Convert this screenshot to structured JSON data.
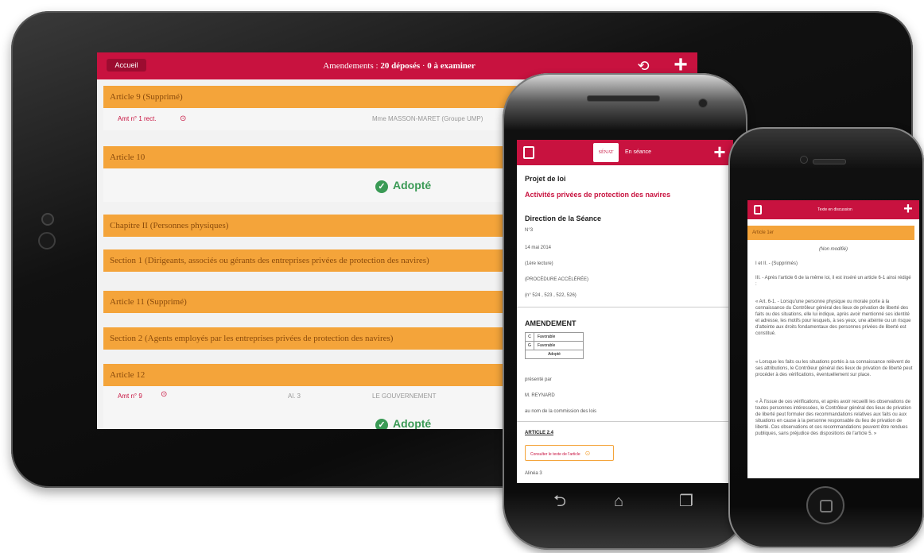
{
  "colors": {
    "brand": "#c8123f",
    "orange": "#f4a43a",
    "green": "#3a9a55"
  },
  "tablet": {
    "home_btn": "Accueil",
    "title_prefix": "Amendements :",
    "title_deposited": "20 déposés",
    "title_sep": "·",
    "title_pending": "0 à examiner",
    "history_icon": "history-icon",
    "plus_icon": "plus-icon",
    "rows": [
      {
        "label": "Article 9 (Supprimé)"
      },
      {
        "amend": "Amt n° 1 rect.",
        "author": "Mme MASSON-MARET (Groupe UMP)"
      },
      {
        "label": "Article 10"
      },
      {
        "status": "Adopté"
      },
      {
        "label": "Chapitre II (Personnes physiques)"
      },
      {
        "label": "Section 1 (Dirigeants, associés ou gérants des entreprises privées de protection des navires)"
      },
      {
        "label": "Article 11 (Supprimé)"
      },
      {
        "label": "Section 2 (Agents employés par les entreprises privées de protection des navires)"
      },
      {
        "label": "Article 12"
      },
      {
        "amend": "Amt n° 9",
        "alinea": "Al. 3",
        "author": "LE GOUVERNEMENT"
      },
      {
        "status": "Adopté"
      }
    ]
  },
  "android": {
    "bar_title": "En séance",
    "logo": "SÉNAT",
    "project_label": "Projet de loi",
    "project_title": "Activités privées de protection des navires",
    "direction": "Direction de la Séance",
    "number": "N°3",
    "date": "14 mai 2014",
    "reading": "(1ère lecture)",
    "procedure": "(PROCÉDURE ACCÉLÉRÉE)",
    "texts": "(n° 524 , 523 , 522, 526)",
    "amendement": "AMENDEMENT",
    "table": [
      {
        "k": "C",
        "v": "Favorable"
      },
      {
        "k": "G",
        "v": "Favorable"
      },
      {
        "k": "",
        "v": "Adopté"
      }
    ],
    "presented_by": "présenté par",
    "author": "M. REYNARD",
    "commission": "au nom de la commission des lois",
    "article": "ARTICLE 2.4",
    "consult_btn": "Consulter le texte de l'article",
    "alinea": "Alinéa 3"
  },
  "iphone": {
    "bar_title": "Texte en discussion",
    "article": "Article 1er",
    "unmodified": "(Non modifié)",
    "p1": "I et II. - (Supprimés)",
    "p2": "III. - Après l'article 6 de la même loi, il est inséré un article 6-1 ainsi rédigé :",
    "p3": "« Art. 6-1. - Lorsqu'une personne physique ou morale porte à la connaissance du Contrôleur général des lieux de privation de liberté des faits ou des situations, elle lui indique, après avoir mentionné ses identité et adresse, les motifs pour lesquels, à ses yeux, une atteinte ou un risque d'atteinte aux droits fondamentaux des personnes privées de liberté est constitué.",
    "p4": "« Lorsque les faits ou les situations portés à sa connaissance relèvent de ses attributions, le Contrôleur général des lieux de privation de liberté peut procéder à des vérifications, éventuellement sur place.",
    "p5": "« À l'issue de ces vérifications, et après avoir recueilli les observations de toutes personnes intéressées, le Contrôleur général des lieux de privation de liberté peut formuler des recommandations relatives aux faits ou aux situations en cause à la personne responsable du lieu de privation de liberté. Ces observations et ces recommandations peuvent être rendues publiques, sans préjudice des dispositions de l'article 5. »"
  }
}
